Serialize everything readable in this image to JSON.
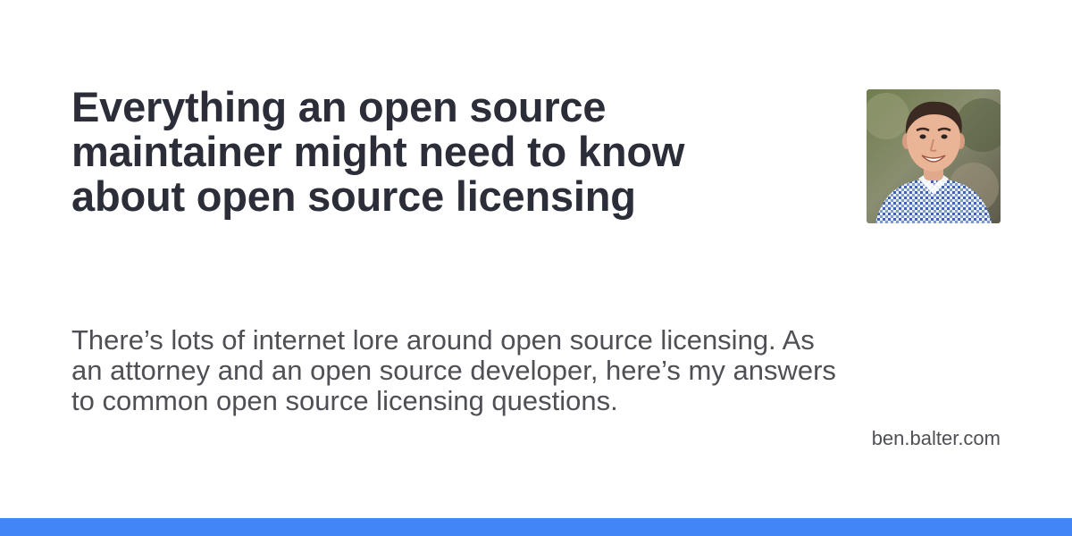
{
  "post": {
    "title": "Everything an open source maintainer might need to know about open source licensing",
    "description": "There’s lots of internet lore around open source licensing. As an attorney and an open source developer, here’s my answers to common open source licensing questions.",
    "domain": "ben.balter.com"
  },
  "author": {
    "avatar_icon": "author-avatar-photo"
  },
  "colors": {
    "accent": "#4285f4",
    "title": "#2b2d38",
    "body_text": "#4f5055",
    "background": "#ffffff"
  }
}
